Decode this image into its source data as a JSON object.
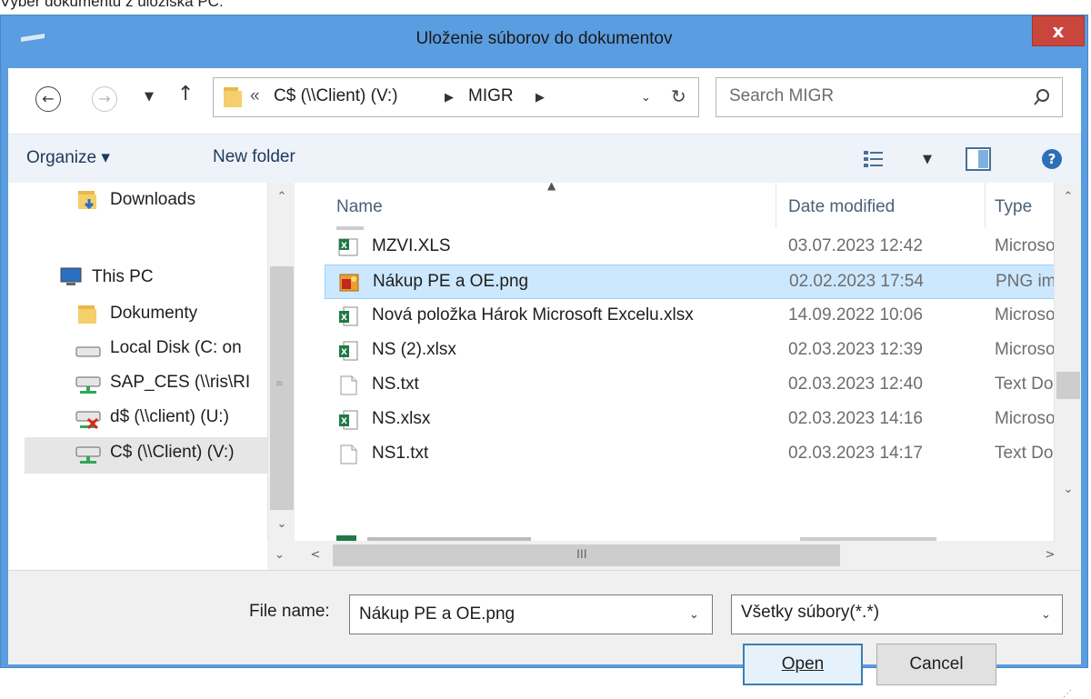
{
  "page_caption": "Výber dokumentu z úložiska PC:",
  "dialog": {
    "title": "Uloženie súborov do dokumentov",
    "close_label": "x"
  },
  "navigation": {
    "address_prefix": "«",
    "breadcrumb": [
      "C$ (\\\\Client) (V:)",
      "MIGR"
    ],
    "search_placeholder": "Search MIGR"
  },
  "commandbar": {
    "organize_label": "Organize ▾",
    "new_folder_label": "New folder"
  },
  "navpane": {
    "items": [
      {
        "label": "Downloads",
        "icon": "downloads-folder-icon"
      },
      {
        "label": "This PC",
        "icon": "this-pc-icon"
      },
      {
        "label": "Dokumenty",
        "icon": "folder-icon"
      },
      {
        "label": "Local Disk (C: on",
        "icon": "local-disk-icon"
      },
      {
        "label": "SAP_CES (\\\\ris\\RI",
        "icon": "network-drive-icon"
      },
      {
        "label": "d$ (\\\\client) (U:)",
        "icon": "disconnected-drive-icon"
      },
      {
        "label": "C$ (\\\\Client) (V:)",
        "icon": "network-drive-icon"
      }
    ]
  },
  "filelist": {
    "columns": [
      "Name",
      "Date modified",
      "Type"
    ],
    "rows": [
      {
        "name": "MZVI.XLS",
        "date": "03.07.2023 12:42",
        "type": "Microsoft",
        "icon": "excel-xls-icon"
      },
      {
        "name": "Nákup PE a OE.png",
        "date": "02.02.2023 17:54",
        "type": "PNG image",
        "icon": "png-image-icon"
      },
      {
        "name": "Nová položka Hárok Microsoft Excelu.xlsx",
        "date": "14.09.2022 10:06",
        "type": "Microsoft",
        "icon": "excel-xlsx-icon"
      },
      {
        "name": "NS (2).xlsx",
        "date": "02.03.2023 12:39",
        "type": "Microsoft",
        "icon": "excel-xlsx-icon"
      },
      {
        "name": "NS.txt",
        "date": "02.03.2023 12:40",
        "type": "Text Doc",
        "icon": "text-file-icon"
      },
      {
        "name": "NS.xlsx",
        "date": "02.03.2023 14:16",
        "type": "Microsoft",
        "icon": "excel-xlsx-icon"
      },
      {
        "name": "NS1.txt",
        "date": "02.03.2023 14:17",
        "type": "Text Doc",
        "icon": "text-file-icon"
      }
    ],
    "hscroll_grip": "III"
  },
  "footer": {
    "file_name_label": "File name:",
    "file_name_value": "Nákup PE a OE.png",
    "filter_value": "Všetky súbory(*.*)",
    "open_label": "Open",
    "cancel_label": "Cancel"
  }
}
